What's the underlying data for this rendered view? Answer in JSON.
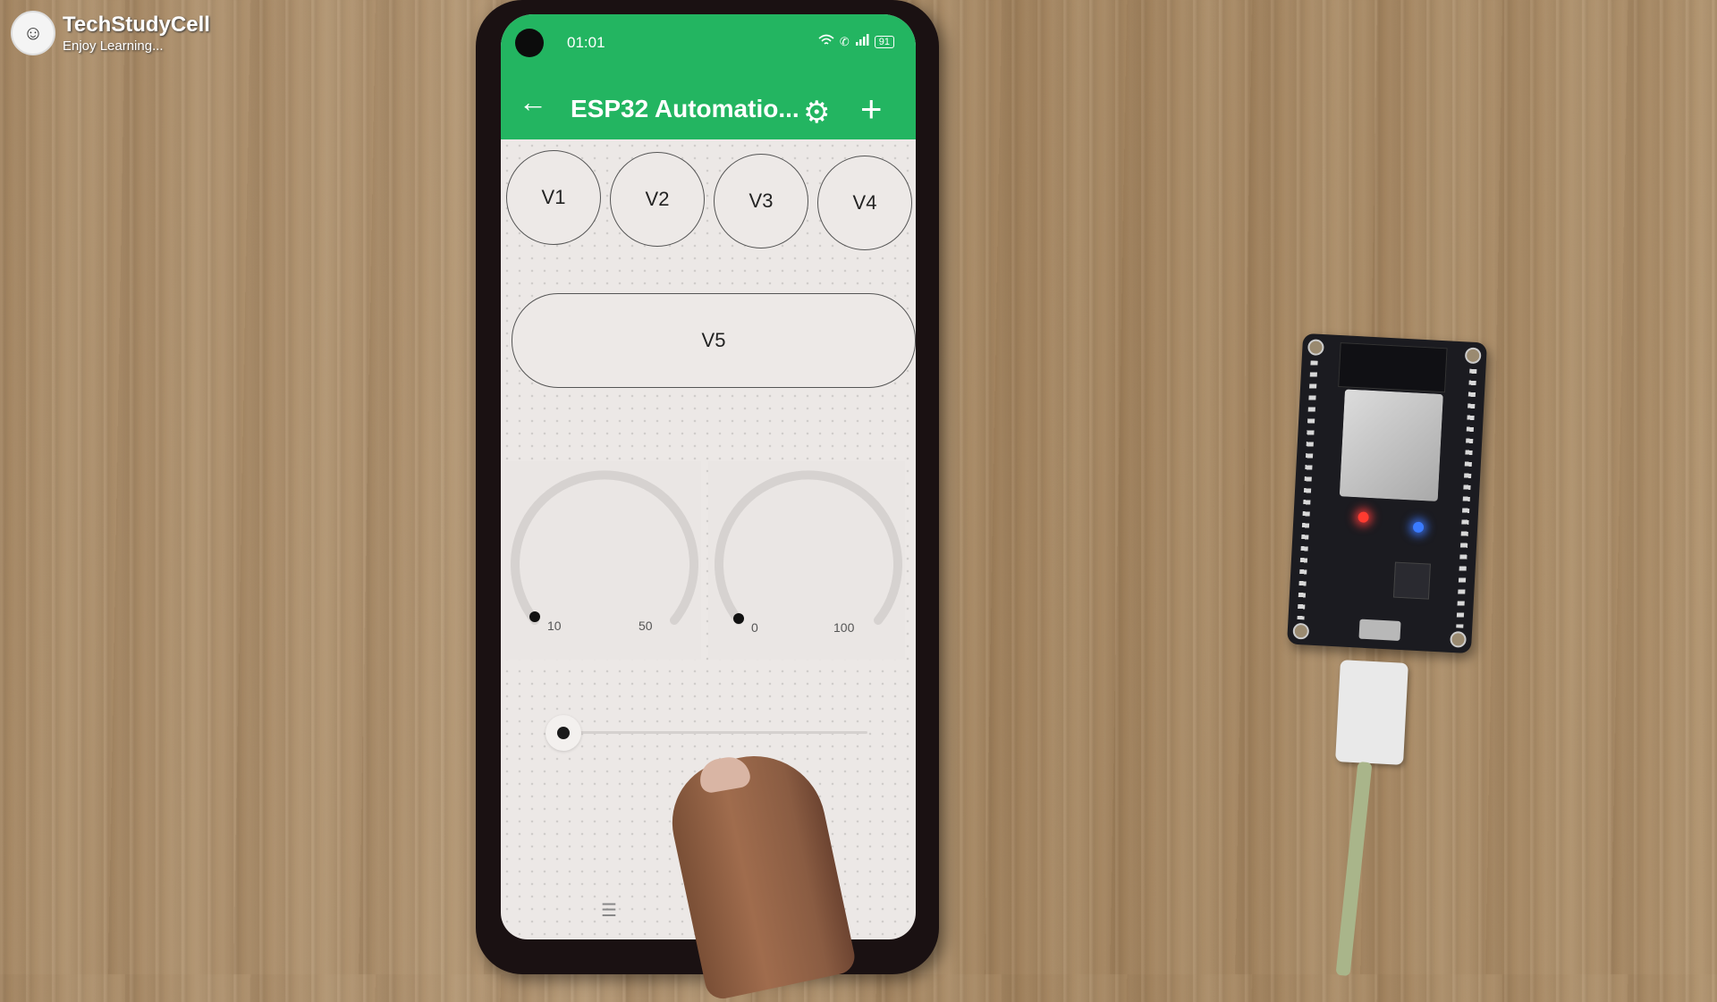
{
  "watermark": {
    "title": "TechStudyCell",
    "subtitle": "Enjoy Learning..."
  },
  "phone": {
    "status": {
      "time": "01:01",
      "battery": "91"
    },
    "header": {
      "title": "ESP32 Automatio..."
    },
    "buttons": [
      "V1",
      "V2",
      "V3",
      "V4"
    ],
    "wide_button": "V5",
    "gauges": [
      {
        "min": "10",
        "max": "50"
      },
      {
        "min": "0",
        "max": "100"
      }
    ],
    "slider": {
      "value": 0
    }
  },
  "colors": {
    "header": "#23b561",
    "background": "#ece8e6"
  },
  "icons": {
    "back": "back-arrow-icon",
    "settings": "gear-icon",
    "add": "plus-icon"
  }
}
